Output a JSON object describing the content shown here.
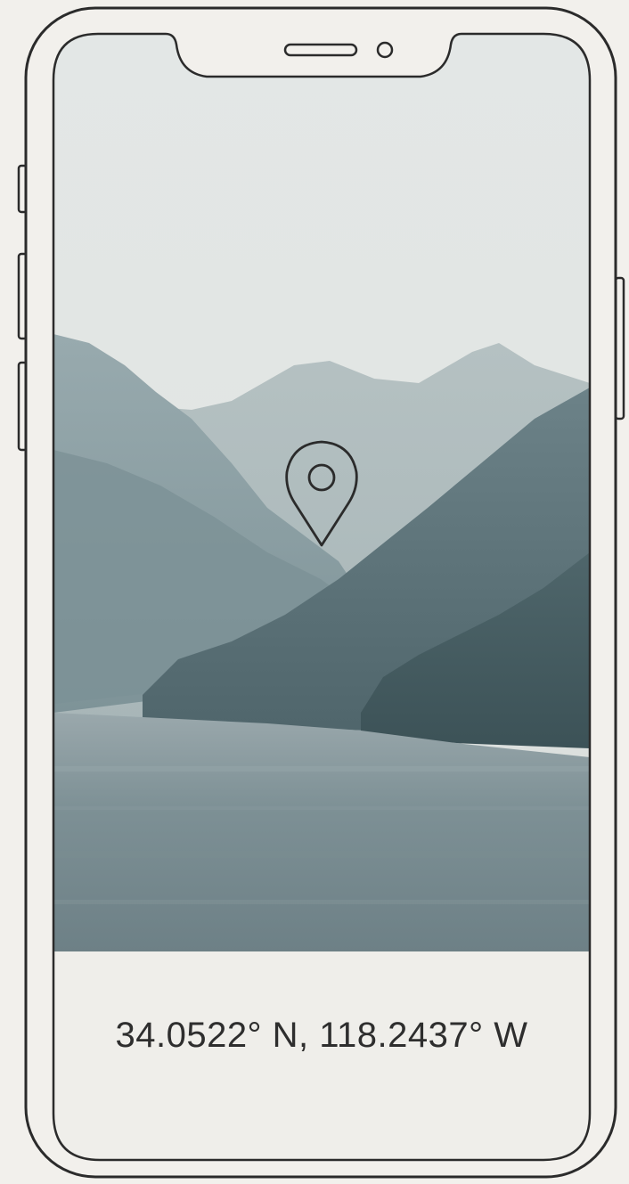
{
  "location": {
    "coordinates": "34.0522° N, 118.2437° W"
  },
  "icons": {
    "pin": "location-pin-icon"
  },
  "colors": {
    "background": "#f2f0ec",
    "outline": "#2b2b2b",
    "sky": "#e4e6e4",
    "water": "#7e9197",
    "text": "#2e2e2e"
  }
}
